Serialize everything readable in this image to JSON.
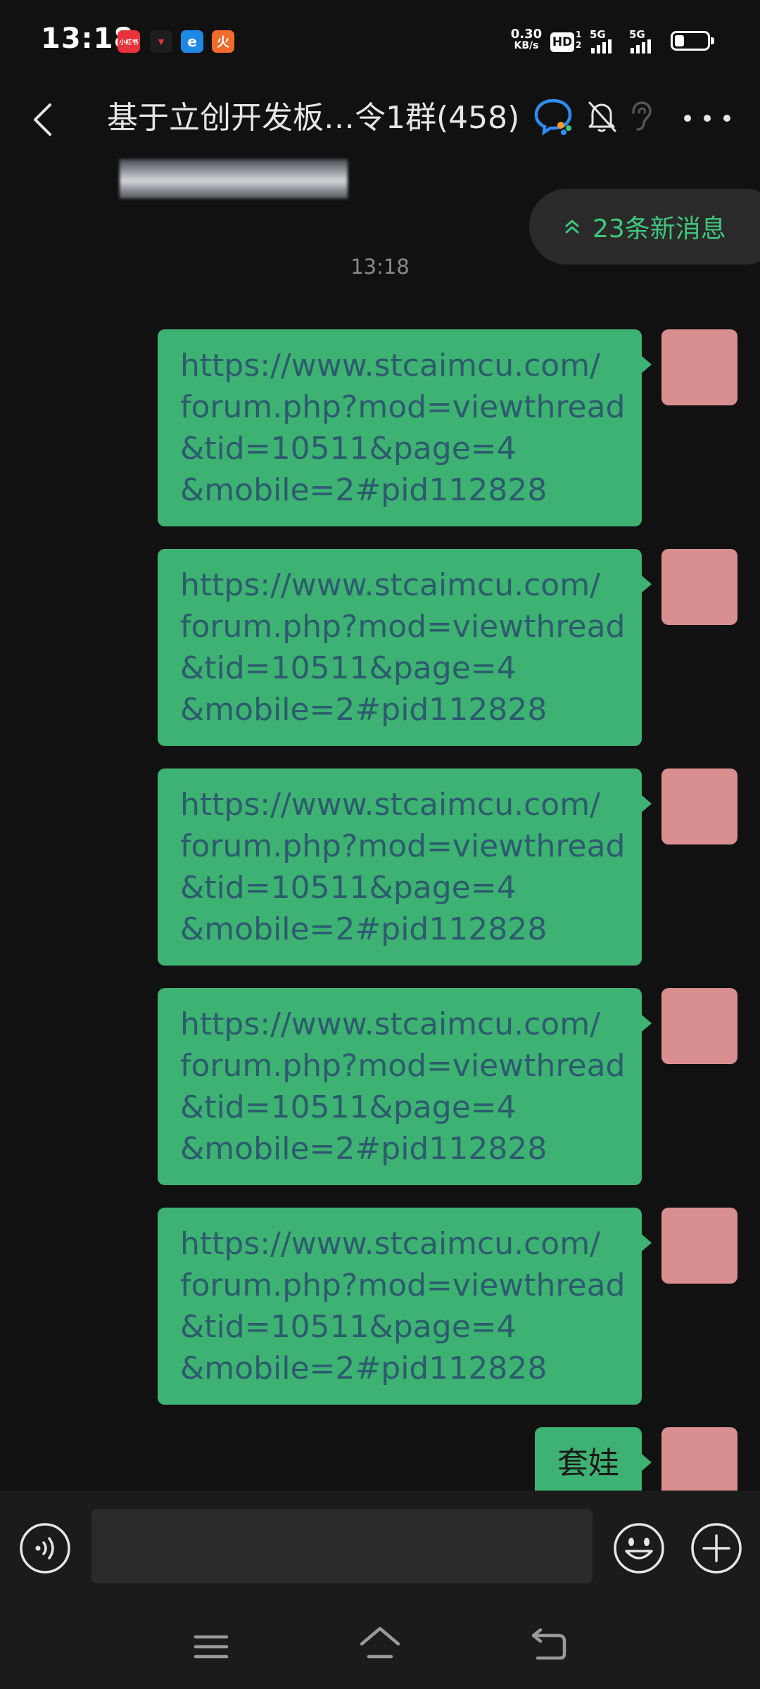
{
  "status_bar": {
    "time": "13:18",
    "app_icons": [
      "小红书",
      "▼",
      "e",
      "火"
    ],
    "net_speed_value": "0.30",
    "net_speed_unit": "KB/s",
    "hd_label": "HD",
    "hd_sub": "1 2",
    "signal_1": "5G",
    "signal_2": "5G",
    "battery_level": 0.3
  },
  "header": {
    "title": "基于立创开发板…令1群(458)",
    "back_icon": "chevron-left-icon",
    "qq_icon": "qq-group-icon",
    "mute_icon": "bell-off-icon",
    "ear_icon": "earpiece-icon",
    "more_icon": "more-dots-icon"
  },
  "messages": {
    "new_messages_pill": "23条新消息",
    "timestamp": "13:18",
    "items": [
      {
        "lines": [
          "https://www.stcaimcu.com/",
          "forum.php?mod=viewthread",
          "&tid=10511&page=4",
          "&mobile=2#pid112828"
        ]
      },
      {
        "lines": [
          "https://www.stcaimcu.com/",
          "forum.php?mod=viewthread",
          "&tid=10511&page=4",
          "&mobile=2#pid112828"
        ]
      },
      {
        "lines": [
          "https://www.stcaimcu.com/",
          "forum.php?mod=viewthread",
          "&tid=10511&page=4",
          "&mobile=2#pid112828"
        ]
      },
      {
        "lines": [
          "https://www.stcaimcu.com/",
          "forum.php?mod=viewthread",
          "&tid=10511&page=4",
          "&mobile=2#pid112828"
        ]
      },
      {
        "lines": [
          "https://www.stcaimcu.com/",
          "forum.php?mod=viewthread",
          "&tid=10511&page=4",
          "&mobile=2#pid112828"
        ]
      }
    ],
    "last_message": "套娃"
  },
  "input_bar": {
    "placeholder": "",
    "voice_icon": "voice-icon",
    "emoji_icon": "emoji-icon",
    "plus_icon": "plus-icon"
  },
  "nav_bar": {
    "menu_icon": "menu-icon",
    "home_icon": "home-icon",
    "back_icon": "back-icon"
  },
  "colors": {
    "background": "#111111",
    "bubble": "#3db272",
    "bubble_link_text": "#2d5b6e",
    "accent_green": "#3ec77d"
  }
}
